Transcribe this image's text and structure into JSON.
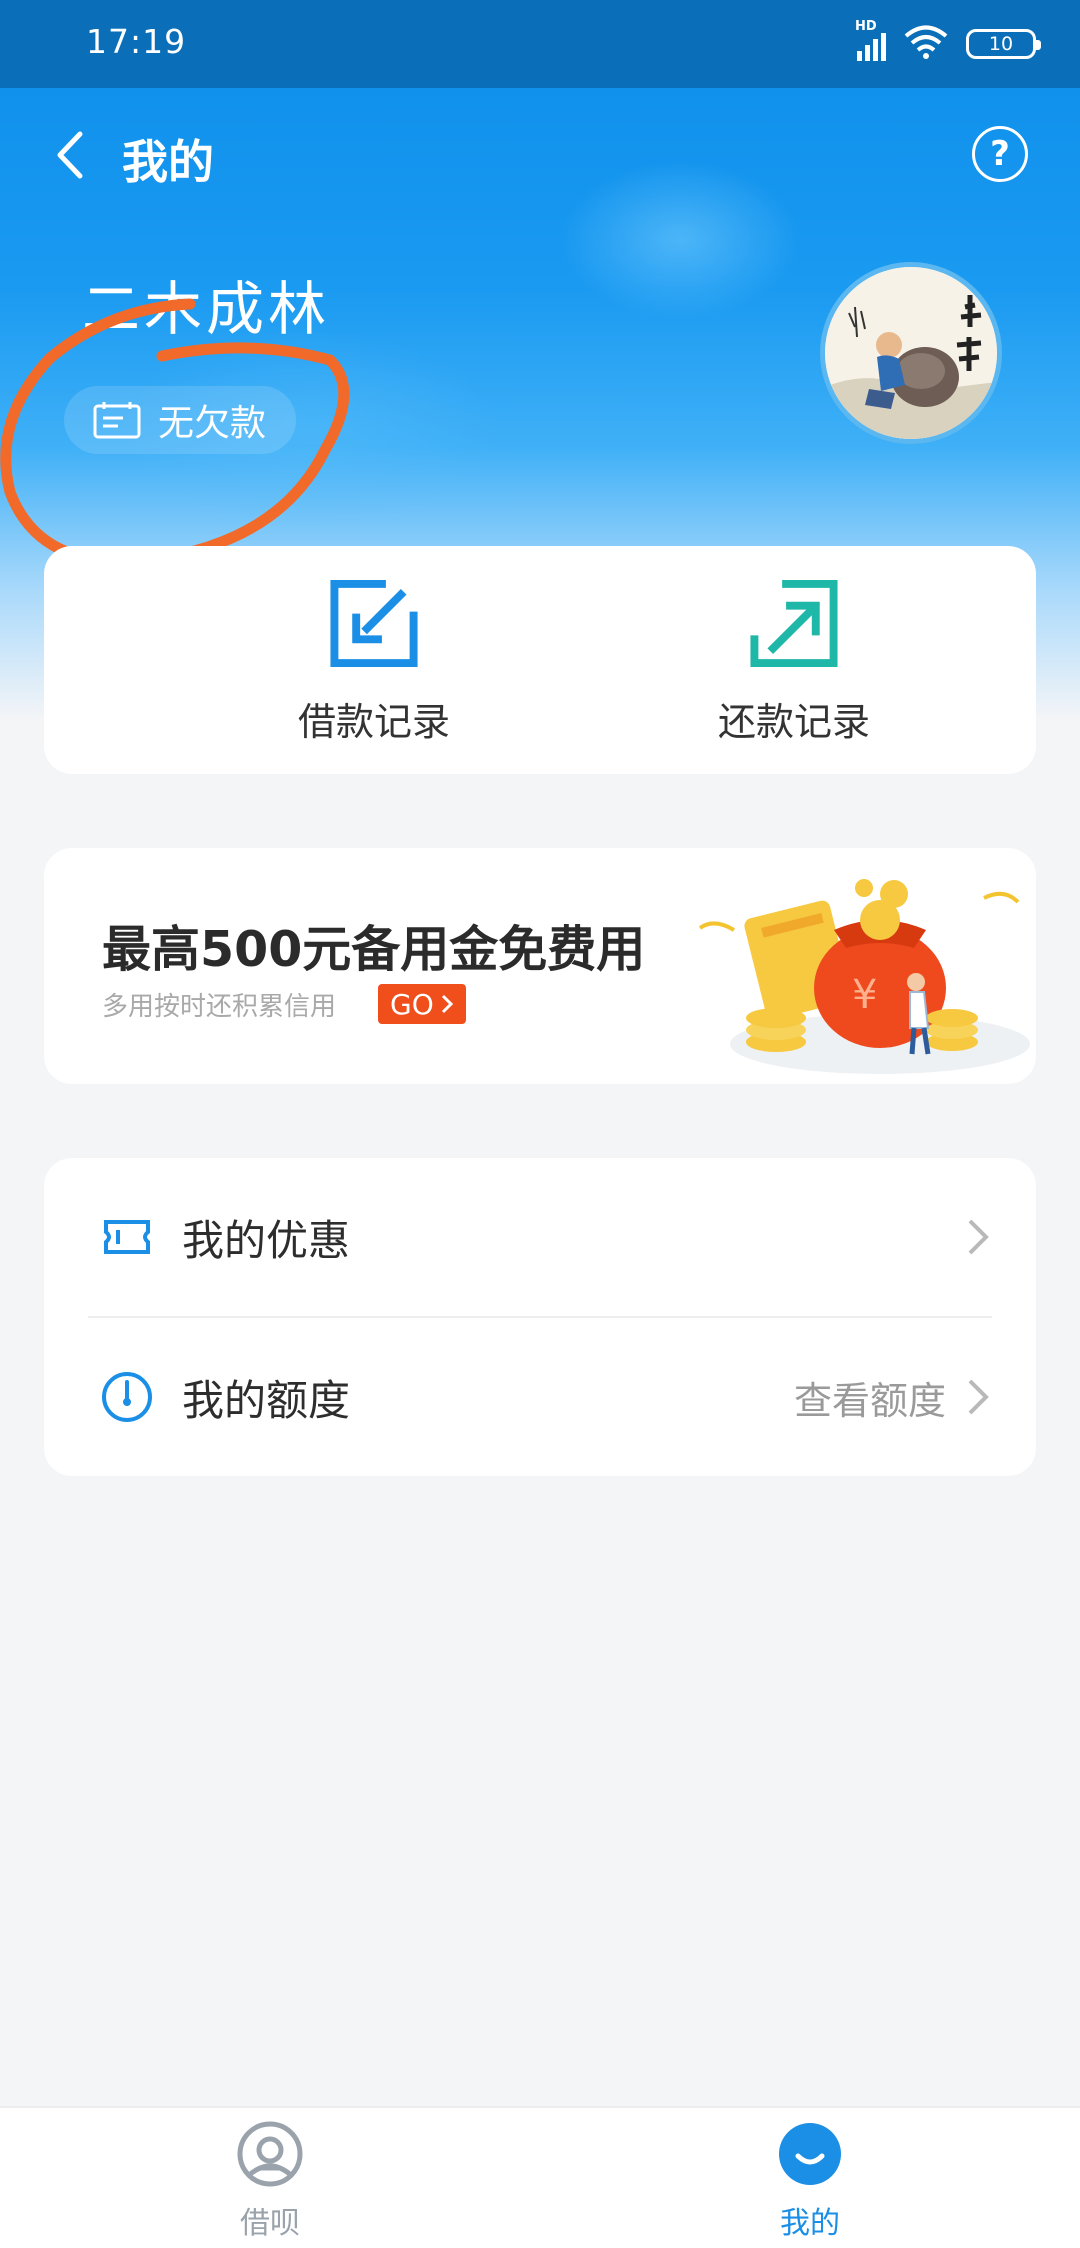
{
  "status_bar": {
    "time": "17:19",
    "network": "HD",
    "battery": "10"
  },
  "header": {
    "title": "我的"
  },
  "profile": {
    "name": "二木成林",
    "debt_status": "无欠款"
  },
  "records": {
    "borrow_label": "借款记录",
    "repay_label": "还款记录"
  },
  "promo": {
    "title": "最高500元备用金免费用",
    "subtitle": "多用按时还积累信用",
    "go_label": "GO"
  },
  "menu": {
    "items": [
      {
        "label": "我的优惠",
        "extra": ""
      },
      {
        "label": "我的额度",
        "extra": "查看额度"
      }
    ]
  },
  "bottom_nav": {
    "items": [
      {
        "label": "借呗",
        "active": false
      },
      {
        "label": "我的",
        "active": true
      }
    ]
  },
  "colors": {
    "brand_blue": "#1b8fe6",
    "repay_green": "#1fb8a8",
    "go_orange": "#f04e1b",
    "annotation_orange": "#f26a2a"
  }
}
